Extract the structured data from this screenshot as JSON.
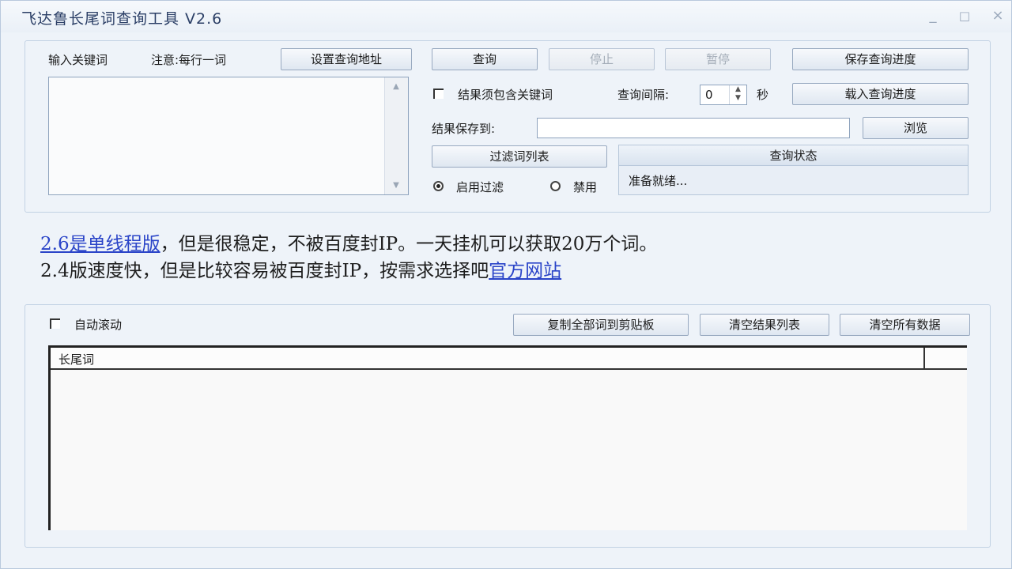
{
  "window": {
    "title": "飞达鲁长尾词查询工具  V2.6",
    "minimize": "_",
    "maximize": "□",
    "close": "×"
  },
  "input_panel": {
    "label_keywords": "输入关键词",
    "label_note": "注意:每行一词",
    "set_address_button": "设置查询地址"
  },
  "controls": {
    "query_button": "查询",
    "stop_button": "停止",
    "pause_button": "暂停",
    "save_progress_button": "保存查询进度",
    "load_progress_button": "载入查询进度",
    "must_contain_label": "结果须包含关键词",
    "interval_label": "查询间隔:",
    "interval_value": "0",
    "interval_unit": "秒",
    "save_to_label": "结果保存到:",
    "save_to_value": "",
    "browse_button": "浏览",
    "filter_list_button": "过滤词列表",
    "enable_filter_label": "启用过滤",
    "disable_filter_label": "禁用"
  },
  "status": {
    "header": "查询状态",
    "text": "准备就绪..."
  },
  "notice": {
    "line1_link": "2.6是单线程版",
    "line1_text": "，但是很稳定，不被百度封IP。一天挂机可以获取20万个词。",
    "line2_text": "2.4版速度快，但是比较容易被百度封IP，按需求选择吧",
    "line2_link": "官方网站"
  },
  "results": {
    "auto_scroll_label": "自动滚动",
    "copy_all_button": "复制全部词到剪贴板",
    "clear_results_button": "清空结果列表",
    "clear_all_button": "清空所有数据",
    "column_header": "长尾词",
    "rows": []
  }
}
